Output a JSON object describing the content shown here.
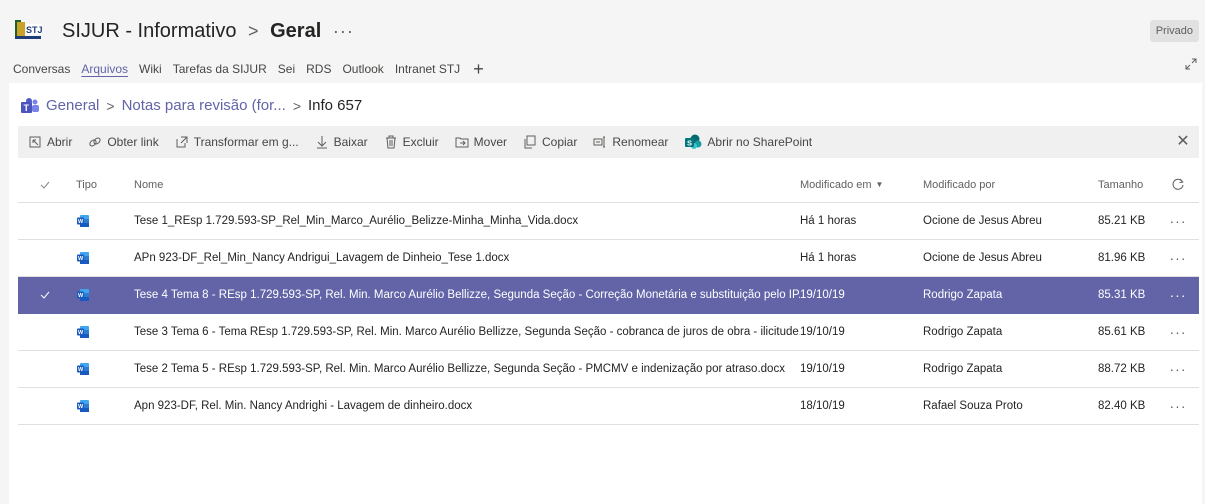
{
  "header": {
    "team": "SIJUR - Informativo",
    "channel": "Geral",
    "more": "···",
    "privacy": "Privado"
  },
  "tabs": [
    {
      "label": "Conversas",
      "active": false
    },
    {
      "label": "Arquivos",
      "active": true
    },
    {
      "label": "Wiki",
      "active": false
    },
    {
      "label": "Tarefas da SIJUR",
      "active": false
    },
    {
      "label": "Sei",
      "active": false
    },
    {
      "label": "RDS",
      "active": false
    },
    {
      "label": "Outlook",
      "active": false
    },
    {
      "label": "Intranet STJ",
      "active": false
    }
  ],
  "breadcrumb": {
    "items": [
      "General",
      "Notas para revisão (for..."
    ],
    "current": "Info 657"
  },
  "toolbar": {
    "open": "Abrir",
    "copy_link": "Obter link",
    "transform": "Transformar em g...",
    "download": "Baixar",
    "delete": "Excluir",
    "move": "Mover",
    "copy": "Copiar",
    "rename": "Renomear",
    "sharepoint": "Abrir no SharePoint"
  },
  "table": {
    "headers": {
      "type": "Tipo",
      "name": "Nome",
      "modified": "Modificado em",
      "modified_by": "Modificado por",
      "size": "Tamanho"
    },
    "rows": [
      {
        "name": "Tese 1_REsp 1.729.593-SP_Rel_Min_Marco_Aurélio_Belizze-Minha_Minha_Vida.docx",
        "modified": "Há 1 horas",
        "modified_by": "Ocione de Jesus Abreu",
        "size": "85.21 KB",
        "selected": false
      },
      {
        "name": "APn 923-DF_Rel_Min_Nancy Andrigui_Lavagem de Dinheio_Tese 1.docx",
        "modified": "Há 1 horas",
        "modified_by": "Ocione de Jesus Abreu",
        "size": "81.96 KB",
        "selected": false
      },
      {
        "name": "Tese 4 Tema 8 - REsp 1.729.593-SP, Rel. Min. Marco Aurélio Bellizze, Segunda Seção - Correção Monetária e substituição pelo IP...",
        "modified": "19/10/19",
        "modified_by": "Rodrigo Zapata",
        "size": "85.31 KB",
        "selected": true
      },
      {
        "name": "Tese 3 Tema 6 - Tema REsp 1.729.593-SP, Rel. Min. Marco Aurélio Bellizze, Segunda Seção - cobranca de juros de obra - ilicitude...",
        "modified": "19/10/19",
        "modified_by": "Rodrigo Zapata",
        "size": "85.61 KB",
        "selected": false
      },
      {
        "name": "Tese 2 Tema 5 - REsp 1.729.593-SP, Rel. Min. Marco Aurélio Bellizze, Segunda Seção - PMCMV e indenização por atraso.docx",
        "modified": "19/10/19",
        "modified_by": "Rodrigo Zapata",
        "size": "88.72 KB",
        "selected": false
      },
      {
        "name": "Apn 923-DF, Rel. Min. Nancy Andrighi - Lavagem de dinheiro.docx",
        "modified": "18/10/19",
        "modified_by": "Rafael Souza Proto",
        "size": "82.40 KB",
        "selected": false
      }
    ]
  },
  "colors": {
    "accent": "#6264a7",
    "word": "#2b579a",
    "panel_bg": "#ffffff",
    "page_bg": "#f5f5f5"
  }
}
